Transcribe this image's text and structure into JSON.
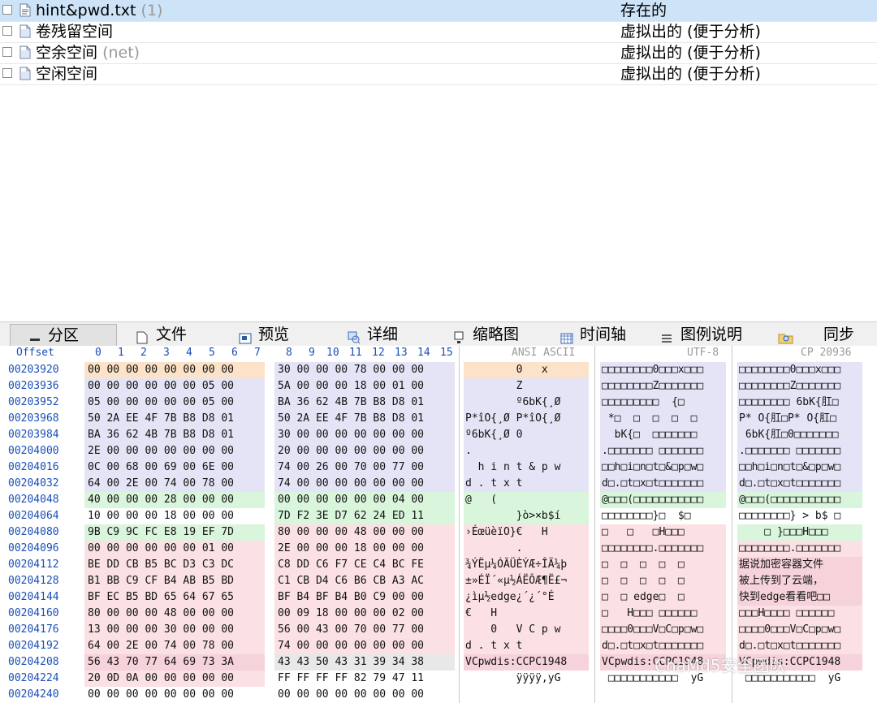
{
  "files": [
    {
      "name": "hint&pwd.txt",
      "suffix": "(1)",
      "type": "存在的",
      "selected": true,
      "icon": "text-file-icon"
    },
    {
      "name": "卷残留空间",
      "suffix": "",
      "type": "虚拟出的 (便于分析)",
      "selected": false,
      "icon": "file-icon"
    },
    {
      "name": "空余空间",
      "suffix": "(net)",
      "type": "虚拟出的 (便于分析)",
      "selected": false,
      "icon": "file-icon"
    },
    {
      "name": "空闲空间",
      "suffix": "",
      "type": "虚拟出的 (便于分析)",
      "selected": false,
      "icon": "file-icon"
    }
  ],
  "tabs": [
    {
      "label": "分区",
      "icon": "minus-icon",
      "active": true
    },
    {
      "label": "文件",
      "icon": "file-icon",
      "active": false
    },
    {
      "label": "预览",
      "icon": "preview-icon",
      "active": false
    },
    {
      "label": "详细",
      "icon": "details-icon",
      "active": false
    },
    {
      "label": "缩略图",
      "icon": "thumbnail-icon",
      "active": false
    },
    {
      "label": "时间轴",
      "icon": "calendar-icon",
      "active": false
    },
    {
      "label": "图例说明",
      "icon": "list-icon",
      "active": false
    },
    {
      "label": "",
      "icon": "search-folder-icon",
      "active": false
    },
    {
      "label": "同步",
      "icon": "",
      "active": false
    }
  ],
  "hex": {
    "offset_header": "Offset",
    "columns": [
      "0",
      "1",
      "2",
      "3",
      "4",
      "5",
      "6",
      "7",
      "8",
      "9",
      "10",
      "11",
      "12",
      "13",
      "14",
      "15"
    ],
    "ansi_header": "ANSI ASCII",
    "utf8_header": "UTF-8",
    "cp_header": "CP 20936",
    "rows": [
      {
        "off": "00203920",
        "b1": "00 00 00 00 00 00 00 00",
        "b2": "30 00 00 00 78 00 00 00",
        "ansi": "        0   x",
        "utf8": "□□□□□□□□0□□□x□□□",
        "cp": "□□□□□□□□0□□□x□□□",
        "c1": "#fbe2c8",
        "c2": "#e4e4f6",
        "ca": "#fbe2c8",
        "cu": "#e4e4f6",
        "cc": "#e4e4f6"
      },
      {
        "off": "00203936",
        "b1": "00 00 00 00 00 00 05 00",
        "b2": "5A 00 00 00 18 00 01 00",
        "ansi": "        Z",
        "utf8": "□□□□□□□□Z□□□□□□□",
        "cp": "□□□□□□□□Z□□□□□□□",
        "c1": "#e4e4f6",
        "c2": "#e4e4f6",
        "ca": "#e4e4f6",
        "cu": "#e4e4f6",
        "cc": "#e4e4f6"
      },
      {
        "off": "00203952",
        "b1": "05 00 00 00 00 00 05 00",
        "b2": "BA 36 62 4B 7B B8 D8 01",
        "ansi": "        º6bK{¸Ø",
        "utf8": "□□□□□□□□□  {□",
        "cp": "□□□□□□□□ 6bK{肛□",
        "c1": "#e4e4f6",
        "c2": "#e4e4f6",
        "ca": "#e4e4f6",
        "cu": "#e4e4f6",
        "cc": "#e4e4f6"
      },
      {
        "off": "00203968",
        "b1": "50 2A EE 4F 7B B8 D8 01",
        "b2": "50 2A EE 4F 7B B8 D8 01",
        "ansi": "P*îO{¸Ø P*îO{¸Ø",
        "utf8": " *□  □  □  □  □",
        "cp": "P* O{肛□P* O{肛□",
        "c1": "#e4e4f6",
        "c2": "#e4e4f6",
        "ca": "#e4e4f6",
        "cu": "#e4e4f6",
        "cc": "#e4e4f6"
      },
      {
        "off": "00203984",
        "b1": "BA 36 62 4B 7B B8 D8 01",
        "b2": "30 00 00 00 00 00 00 00",
        "ansi": "º6bK{¸Ø 0",
        "utf8": "  bK{□  □□□□□□□",
        "cp": " 6bK{肛□0□□□□□□□",
        "c1": "#e4e4f6",
        "c2": "#e4e4f6",
        "ca": "#e4e4f6",
        "cu": "#e4e4f6",
        "cc": "#e4e4f6"
      },
      {
        "off": "00204000",
        "b1": "2E 00 00 00 00 00 00 00",
        "b2": "20 00 00 00 00 00 00 00",
        "ansi": ".",
        "utf8": ".□□□□□□□ □□□□□□□",
        "cp": ".□□□□□□□ □□□□□□□",
        "c1": "#e4e4f6",
        "c2": "#e4e4f6",
        "ca": "#e4e4f6",
        "cu": "#e4e4f6",
        "cc": "#e4e4f6"
      },
      {
        "off": "00204016",
        "b1": "0C 00 68 00 69 00 6E 00",
        "b2": "74 00 26 00 70 00 77 00",
        "ansi": "  h i n t & p w",
        "utf8": "□□h□i□n□t□&□p□w□",
        "cp": "□□h□i□n□t□&□p□w□",
        "c1": "#e4e4f6",
        "c2": "#e4e4f6",
        "ca": "#e4e4f6",
        "cu": "#e4e4f6",
        "cc": "#e4e4f6"
      },
      {
        "off": "00204032",
        "b1": "64 00 2E 00 74 00 78 00",
        "b2": "74 00 00 00 00 00 00 00",
        "ansi": "d . t x t",
        "utf8": "d□.□t□x□t□□□□□□□",
        "cp": "d□.□t□x□t□□□□□□□",
        "c1": "#e4e4f6",
        "c2": "#e4e4f6",
        "ca": "#e4e4f6",
        "cu": "#e4e4f6",
        "cc": "#e4e4f6"
      },
      {
        "off": "00204048",
        "b1": "40 00 00 00 28 00 00 00",
        "b2": "00 00 00 00 00 00 04 00",
        "ansi": "@   (",
        "utf8": "@□□□(□□□□□□□□□□□",
        "cp": "@□□□(□□□□□□□□□□□",
        "c1": "#d9f5dc",
        "c2": "#d9f5dc",
        "ca": "#d9f5dc",
        "cu": "#d9f5dc",
        "cc": "#d9f5dc"
      },
      {
        "off": "00204064",
        "b1": "10 00 00 00 18 00 00 00",
        "b2": "7D F2 3E D7 62 24 ED 11",
        "ansi": "        }ò>×b$í",
        "utf8": "□□□□□□□□}□  $□",
        "cp": "□□□□□□□□} > b$ □",
        "c1": "#ffffff",
        "c2": "#d9f5dc",
        "ca": "#d9f5dc",
        "cu": "#ffffff",
        "cc": "#ffffff"
      },
      {
        "off": "00204080",
        "b1": "9B C9 9C FC E8 19 EF 7D",
        "b2": "80 00 00 00 48 00 00 00",
        "ansi": "›ÉœüèïO}€   H",
        "utf8": "□   □   □H□□□",
        "cp": "    □ }□□□H□□□",
        "c1": "#d9f5dc",
        "c2": "#fbe0e4",
        "ca": "#fbe0e4",
        "cu": "#fbe0e4",
        "cc": "#d9f5dc"
      },
      {
        "off": "00204096",
        "b1": "00 00 00 00 00 00 01 00",
        "b2": "2E 00 00 00 18 00 00 00",
        "ansi": "        .",
        "utf8": "□□□□□□□□.□□□□□□□",
        "cp": "□□□□□□□□.□□□□□□□",
        "c1": "#fbe0e4",
        "c2": "#fbe0e4",
        "ca": "#fbe0e4",
        "cu": "#fbe0e4",
        "cc": "#fbe0e4"
      },
      {
        "off": "00204112",
        "b1": "BE DD CB B5 BC D3 C3 DC",
        "b2": "C8 DD C6 F7 CE C4 BC FE",
        "ansi": "¾ÝËµ¼ÓÃÜÈÝÆ÷ÎÄ¼þ",
        "utf8": "□  □  □  □  □",
        "cp": "据说加密容器文件",
        "c1": "#fbe0e4",
        "c2": "#fbe0e4",
        "ca": "#fbe0e4",
        "cu": "#fbe0e4",
        "cc": "#f6d2da"
      },
      {
        "off": "00204128",
        "b1": "B1 BB C9 CF B4 AB B5 BD",
        "b2": "C1 CB D4 C6 B6 CB A3 AC",
        "ansi": "±»ÉÏ´«µ½ÁËÔÆ¶Ë£¬",
        "utf8": "□  □  □  □  □",
        "cp": "被上传到了云端，",
        "c1": "#fbe0e4",
        "c2": "#fbe0e4",
        "ca": "#fbe0e4",
        "cu": "#fbe0e4",
        "cc": "#f6d2da"
      },
      {
        "off": "00204144",
        "b1": "BF EC B5 BD 65 64 67 65",
        "b2": "BF B4 BF B4 B0 C9 00 00",
        "ansi": "¿ìµ½edge¿´¿´°É",
        "utf8": "□  □ edge□  □",
        "cp": "快到edge看看吧□□",
        "c1": "#fbe0e4",
        "c2": "#fbe0e4",
        "ca": "#fbe0e4",
        "cu": "#fbe0e4",
        "cc": "#f6d2da"
      },
      {
        "off": "00204160",
        "b1": "80 00 00 00 48 00 00 00",
        "b2": "00 09 18 00 00 00 02 00",
        "ansi": "€   H",
        "utf8": "□   H□□□ □□□□□□",
        "cp": "□□□H□□□□ □□□□□□",
        "c1": "#fbe0e4",
        "c2": "#fbe0e4",
        "ca": "#fbe0e4",
        "cu": "#fbe0e4",
        "cc": "#fbe0e4"
      },
      {
        "off": "00204176",
        "b1": "13 00 00 00 30 00 00 00",
        "b2": "56 00 43 00 70 00 77 00",
        "ansi": "    0   V C p w",
        "utf8": "□□□□0□□□V□C□p□w□",
        "cp": "□□□□0□□□V□C□p□w□",
        "c1": "#fbe0e4",
        "c2": "#fbe0e4",
        "ca": "#fbe0e4",
        "cu": "#fbe0e4",
        "cc": "#fbe0e4"
      },
      {
        "off": "00204192",
        "b1": "64 00 2E 00 74 00 78 00",
        "b2": "74 00 00 00 00 00 00 00",
        "ansi": "d . t x t",
        "utf8": "d□.□t□x□t□□□□□□□",
        "cp": "d□.□t□x□t□□□□□□□",
        "c1": "#fbe0e4",
        "c2": "#fbe0e4",
        "ca": "#fbe0e4",
        "cu": "#fbe0e4",
        "cc": "#fbe0e4"
      },
      {
        "off": "00204208",
        "b1": "56 43 70 77 64 69 73 3A",
        "b2": "43 43 50 43 31 39 34 38",
        "ansi": "VCpwdis:CCPC1948",
        "utf8": "VCpwdis:CCPC1948",
        "cp": "VCpwdis:CCPC1948",
        "c1": "#f6d2da",
        "c2": "#e8e8e8",
        "ca": "#f6d2da",
        "cu": "#f6d2da",
        "cc": "#f6d2da"
      },
      {
        "off": "00204224",
        "b1": "20 0D 0A 00 00 00 00 00",
        "b2": "FF FF FF FF 82 79 47 11",
        "ansi": "        ÿÿÿÿ‚yG",
        "utf8": " □□□□□□□□□□□  yG",
        "cp": " □□□□□□□□□□□  yG",
        "c1": "#fbe0e4",
        "c2": "#ffffff",
        "ca": "#ffffff",
        "cu": "#ffffff",
        "cc": "#ffffff"
      },
      {
        "off": "00204240",
        "b1": "00 00 00 00 00 00 00 00",
        "b2": "00 00 00 00 00 00 00 00",
        "ansi": "",
        "utf8": "",
        "cp": "",
        "c1": "#ffffff",
        "c2": "#ffffff",
        "ca": "#ffffff",
        "cu": "#ffffff",
        "cc": "#ffffff"
      }
    ]
  },
  "watermark": "ChaMd5安全团队"
}
